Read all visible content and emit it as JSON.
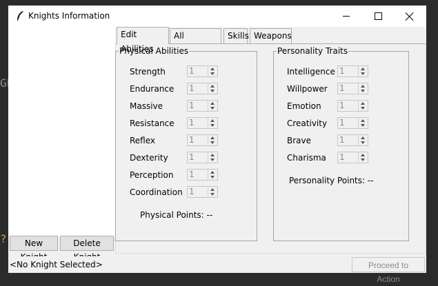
{
  "window": {
    "title": "Knights Information"
  },
  "background": {
    "left_text": "GE",
    "left_brackets": "?)"
  },
  "list_buttons": {
    "new": "New Knight",
    "delete": "Delete Knight"
  },
  "tabs": [
    {
      "label": "Edit Abilities",
      "active": true
    },
    {
      "label": "All Statistics",
      "active": false
    },
    {
      "label": "Skills",
      "active": false
    },
    {
      "label": "Weapons",
      "active": false
    }
  ],
  "physical": {
    "title": "Physical Abilities",
    "rows": [
      {
        "label": "Strength",
        "value": "1"
      },
      {
        "label": "Endurance",
        "value": "1"
      },
      {
        "label": "Massive",
        "value": "1"
      },
      {
        "label": "Resistance",
        "value": "1"
      },
      {
        "label": "Reflex",
        "value": "1"
      },
      {
        "label": "Dexterity",
        "value": "1"
      },
      {
        "label": "Perception",
        "value": "1"
      },
      {
        "label": "Coordination",
        "value": "1"
      }
    ],
    "points": "Physical Points: --"
  },
  "personality": {
    "title": "Personality Traits",
    "rows": [
      {
        "label": "Intelligence",
        "value": "1"
      },
      {
        "label": "Willpower",
        "value": "1"
      },
      {
        "label": "Emotion",
        "value": "1"
      },
      {
        "label": "Creativity",
        "value": "1"
      },
      {
        "label": "Brave",
        "value": "1"
      },
      {
        "label": "Charisma",
        "value": "1"
      }
    ],
    "points": "Personality Points: --"
  },
  "status": {
    "text": "<No Knight Selected>",
    "proceed": "Proceed to Action"
  }
}
